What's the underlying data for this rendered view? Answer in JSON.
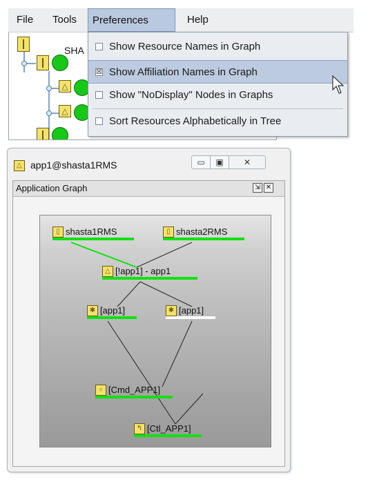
{
  "menubar": {
    "items": [
      "File",
      "Tools",
      "Preferences",
      "Help"
    ],
    "active": "Preferences"
  },
  "tree": {
    "root_label": "SHA"
  },
  "preferences_menu": {
    "items": [
      {
        "label": "Show Resource Names in Graph",
        "checked": false
      },
      {
        "label": "Show Affiliation Names in Graph",
        "checked": true
      },
      {
        "label": "Show \"NoDisplay\" Nodes in Graphs",
        "checked": false
      },
      {
        "label": "Sort Resources Alphabetically in Tree",
        "checked": false
      }
    ],
    "checked_glyph": "☒",
    "unchecked_glyph": ""
  },
  "window": {
    "title": "app1@shasta1RMS",
    "title_icon": "application-triangle-icon",
    "buttons": {
      "minimize": "▭",
      "maximize": "▣",
      "close": "✕"
    }
  },
  "graph_panel": {
    "title": "Application Graph",
    "float_glyph": "⇲",
    "close_glyph": "✕"
  },
  "graph": {
    "nodes": [
      {
        "id": "shasta1",
        "label": "shasta1RMS",
        "icon": "system-icon",
        "glyph": "▯",
        "bar": "green"
      },
      {
        "id": "shasta2",
        "label": "shasta2RMS",
        "icon": "system-icon",
        "glyph": "▯",
        "bar": "green"
      },
      {
        "id": "app1",
        "label": "[!app1]  -  app1",
        "icon": "application-triangle-icon",
        "glyph": "△",
        "bar": "green"
      },
      {
        "id": "c1",
        "label": "[app1]",
        "icon": "controller-star-icon",
        "glyph": "✱",
        "bar": "green"
      },
      {
        "id": "c2",
        "label": "[app1]",
        "icon": "controller-star-icon",
        "glyph": "✱",
        "bar": "white"
      },
      {
        "id": "cmd",
        "label": "[Cmd_APP1]",
        "icon": "cmdline-icon",
        "glyph": "○",
        "bar": "green"
      },
      {
        "id": "ctl",
        "label": "[Ctl_APP1]",
        "icon": "controller-arrow-icon",
        "glyph": "↰",
        "bar": "green"
      }
    ],
    "edges": [
      {
        "from": "shasta1",
        "to": "app1",
        "color": "#13e013"
      },
      {
        "from": "shasta2",
        "to": "app1",
        "color": "#222222"
      },
      {
        "from": "app1",
        "to": "c1",
        "color": "#222222"
      },
      {
        "from": "app1",
        "to": "c2",
        "color": "#222222"
      },
      {
        "from": "c1",
        "to": "ctl",
        "color": "#222222"
      },
      {
        "from": "c2",
        "to": "cmd",
        "color": "#222222"
      },
      {
        "from": "cmd",
        "to": "ctl",
        "color": "#222222"
      }
    ]
  }
}
